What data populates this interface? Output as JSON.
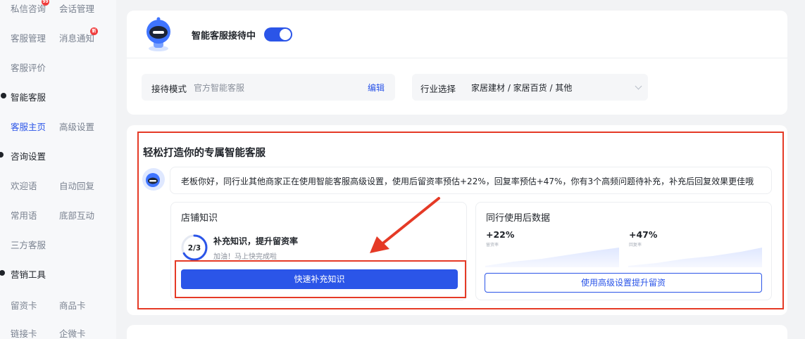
{
  "sidebar": {
    "items": [
      {
        "label": "私信咨询",
        "badge": "99"
      },
      {
        "label": "会话管理"
      },
      {
        "label": "客服管理"
      },
      {
        "label": "消息通知",
        "badge": "新"
      },
      {
        "label": "客服评价"
      },
      {
        "label": "智能客服"
      },
      {
        "label": "客服主页"
      },
      {
        "label": "高级设置"
      },
      {
        "label": "咨询设置"
      },
      {
        "label": "欢迎语"
      },
      {
        "label": "自动回复"
      },
      {
        "label": "常用语"
      },
      {
        "label": "底部互动"
      },
      {
        "label": "三方客服"
      },
      {
        "label": "营销工具"
      },
      {
        "label": "留资卡"
      },
      {
        "label": "商品卡"
      },
      {
        "label": "链接卡"
      },
      {
        "label": "企微卡"
      }
    ]
  },
  "header": {
    "title": "智能客服接待中",
    "toggle_on": true
  },
  "settings": {
    "mode_label": "接待模式",
    "mode_value": "官方智能客服",
    "edit_label": "编辑",
    "industry_label": "行业选择",
    "industry_value": "家居建材 / 家居百货 / 其他"
  },
  "main": {
    "title": "轻松打造你的专属智能客服",
    "message": "老板你好，同行业其他商家正在使用智能客服高级设置，使用后留资率预估+22%，回复率预估+47%，你有3个高频问题待补充，补充后回复效果更佳哦",
    "store": {
      "title": "店铺知识",
      "progress": "2/3",
      "progress_fraction": 0.667,
      "tip_title": "补充知识，提升留资率",
      "tip_sub": "加油！马上快完成啦",
      "button": "快速补充知识"
    },
    "peer": {
      "title": "同行使用后数据",
      "stats": [
        {
          "value": "+22%",
          "label": "留资率"
        },
        {
          "value": "+47%",
          "label": "回复率"
        }
      ],
      "button": "使用高级设置提升留资"
    }
  },
  "colors": {
    "accent": "#2b55e8",
    "annotation": "#e53a26"
  }
}
